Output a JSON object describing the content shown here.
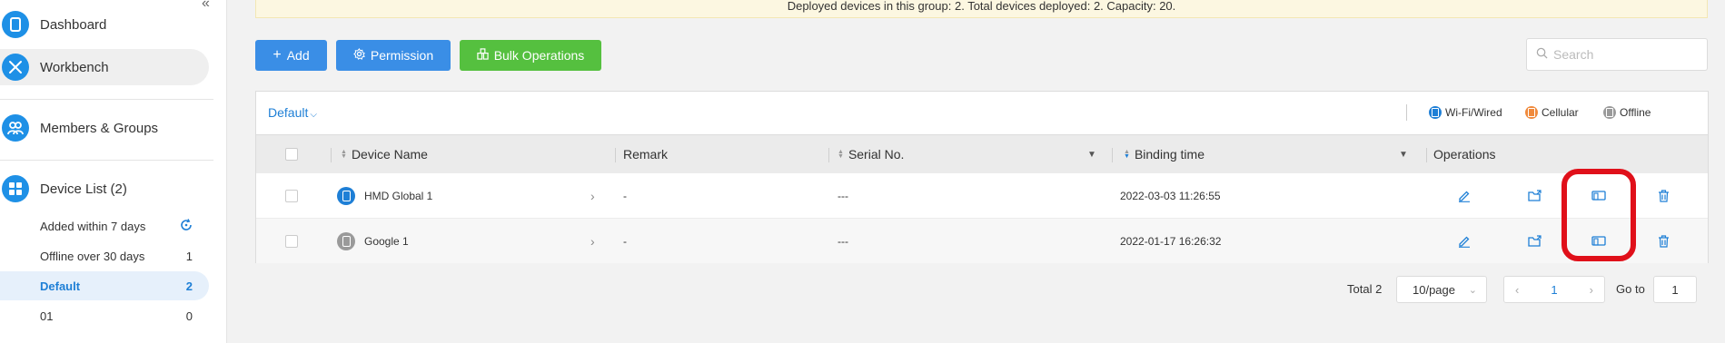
{
  "sidebar": {
    "dashboard_label": "Dashboard",
    "workbench_label": "Workbench",
    "members_label": "Members & Groups",
    "device_list_label": "Device List (2)",
    "sub_items": [
      {
        "label": "Added within 7 days",
        "count": ""
      },
      {
        "label": "Offline over 30 days",
        "count": "1"
      },
      {
        "label": "Default",
        "count": "2"
      },
      {
        "label": "01",
        "count": "0"
      }
    ]
  },
  "banner": {
    "text": "Deployed devices in this group: 2. Total devices deployed: 2. Capacity: 20."
  },
  "toolbar": {
    "add_label": "Add",
    "permission_label": "Permission",
    "bulk_label": "Bulk Operations",
    "search_placeholder": "Search"
  },
  "filter": {
    "group_label": "Default",
    "legend": [
      {
        "label": "Wi-Fi/Wired",
        "color": "#1e7fd6"
      },
      {
        "label": "Cellular",
        "color": "#f08a3c"
      },
      {
        "label": "Offline",
        "color": "#9a9a9a"
      }
    ]
  },
  "table": {
    "headers": {
      "device_name": "Device Name",
      "remark": "Remark",
      "serial": "Serial No.",
      "binding_time": "Binding time",
      "operations": "Operations"
    },
    "rows": [
      {
        "name": "HMD Global 1",
        "remark": "-",
        "serial": "---",
        "binding_time": "2022-03-03 11:26:55",
        "status": "online",
        "status_color": "#1e7fd6"
      },
      {
        "name": "Google 1",
        "remark": "-",
        "serial": "---",
        "binding_time": "2022-01-17 16:26:32",
        "status": "offline",
        "status_color": "#9a9a9a"
      }
    ]
  },
  "pagination": {
    "total": "Total 2",
    "page_size": "10/page",
    "current_page": "1",
    "goto_label": "Go to",
    "goto_value": "1"
  },
  "colors": {
    "primary": "#3a8ee6",
    "success": "#55c03f",
    "highlight": "#e0101a",
    "icon_blue": "#1e7fd6"
  }
}
